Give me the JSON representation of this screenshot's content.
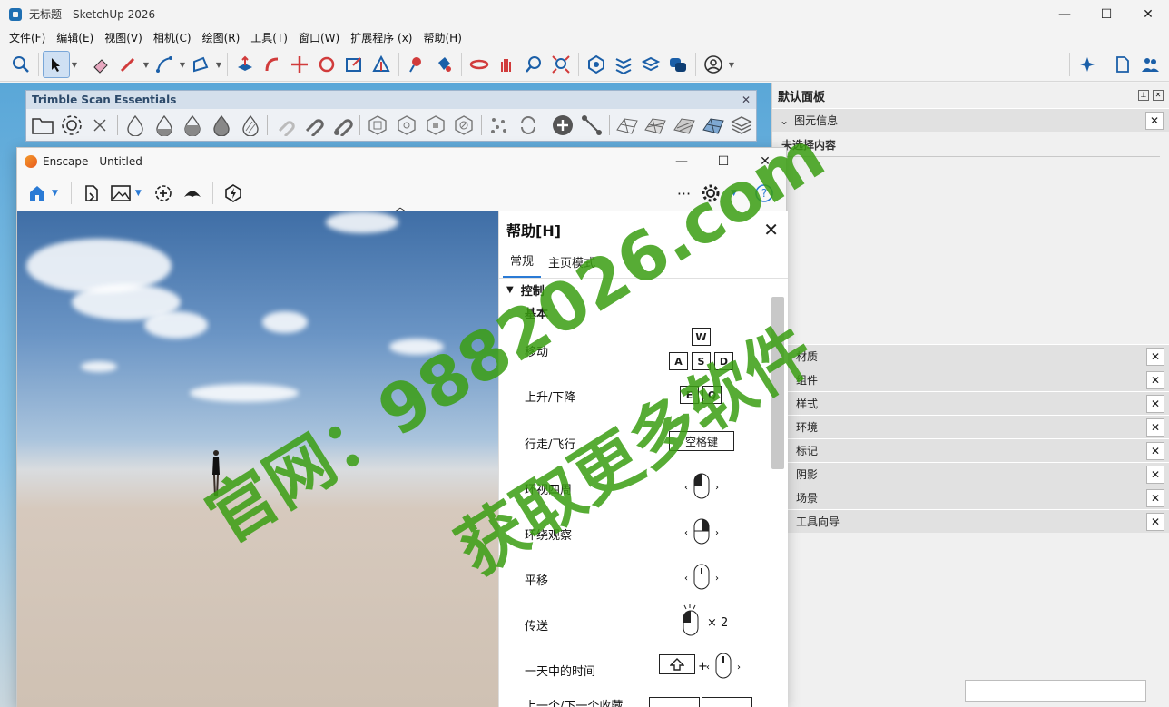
{
  "window": {
    "title": "无标题 - SketchUp 2026",
    "minimize": "—",
    "maximize": "☐",
    "close": "✕"
  },
  "menu": [
    "文件(F)",
    "编辑(E)",
    "视图(V)",
    "相机(C)",
    "绘图(R)",
    "工具(T)",
    "窗口(W)",
    "扩展程序 (x)",
    "帮助(H)"
  ],
  "scan_toolbar": {
    "title": "Trimble Scan Essentials",
    "close": "✕"
  },
  "default_tray": {
    "title": "默认面板",
    "entity_info": {
      "label": "图元信息",
      "empty_text": "未选择内容"
    },
    "trays": [
      "材质",
      "组件",
      "样式",
      "环境",
      "标记",
      "阴影",
      "场景",
      "工具向导"
    ],
    "close": "✕"
  },
  "enscape": {
    "title": "Enscape - Untitled",
    "minimize": "—",
    "maximize": "☐",
    "close": "✕",
    "more": "···",
    "help": {
      "title": "帮助[H]",
      "close": "✕",
      "tabs": [
        "常规",
        "主页模式"
      ],
      "section": "控制",
      "subsection": "基本",
      "rows": [
        {
          "label": "移动",
          "keys": [
            "W",
            "A",
            "S",
            "D"
          ]
        },
        {
          "label": "上升/下降",
          "keys": [
            "E",
            "Q"
          ]
        },
        {
          "label": "行走/飞行",
          "keys": [
            "空格键"
          ]
        },
        {
          "label": "环视四周",
          "mouse": "left"
        },
        {
          "label": "环绕观察",
          "mouse": "right"
        },
        {
          "label": "平移",
          "mouse": "middle"
        },
        {
          "label": "传送",
          "mouse": "double",
          "suffix": "× 2"
        },
        {
          "label": "一天中的时间",
          "mouse": "shift",
          "plus": "+"
        },
        {
          "label": "上一个/下一个收藏"
        }
      ]
    }
  },
  "watermark": {
    "line1": "官网：9882026.com",
    "line2": "获取更多软件"
  }
}
